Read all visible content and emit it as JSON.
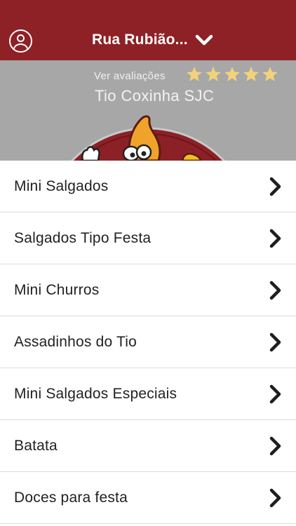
{
  "header": {
    "location": "Rua Rubião...",
    "location_icon": "chevron-down-icon",
    "profile_icon": "user-circle-icon",
    "background_color": "#8e2126"
  },
  "store": {
    "reviews_link": "Ver avaliações",
    "rating": 5,
    "rating_max": 5,
    "star_color": "#f3d27a",
    "name": "Tio Coxinha SJC"
  },
  "categories": [
    {
      "label": "Mini Salgados"
    },
    {
      "label": "Salgados Tipo Festa"
    },
    {
      "label": "Mini Churros"
    },
    {
      "label": "Assadinhos do Tio"
    },
    {
      "label": "Mini Salgados Especiais"
    },
    {
      "label": "Batata"
    },
    {
      "label": "Doces para festa"
    }
  ]
}
